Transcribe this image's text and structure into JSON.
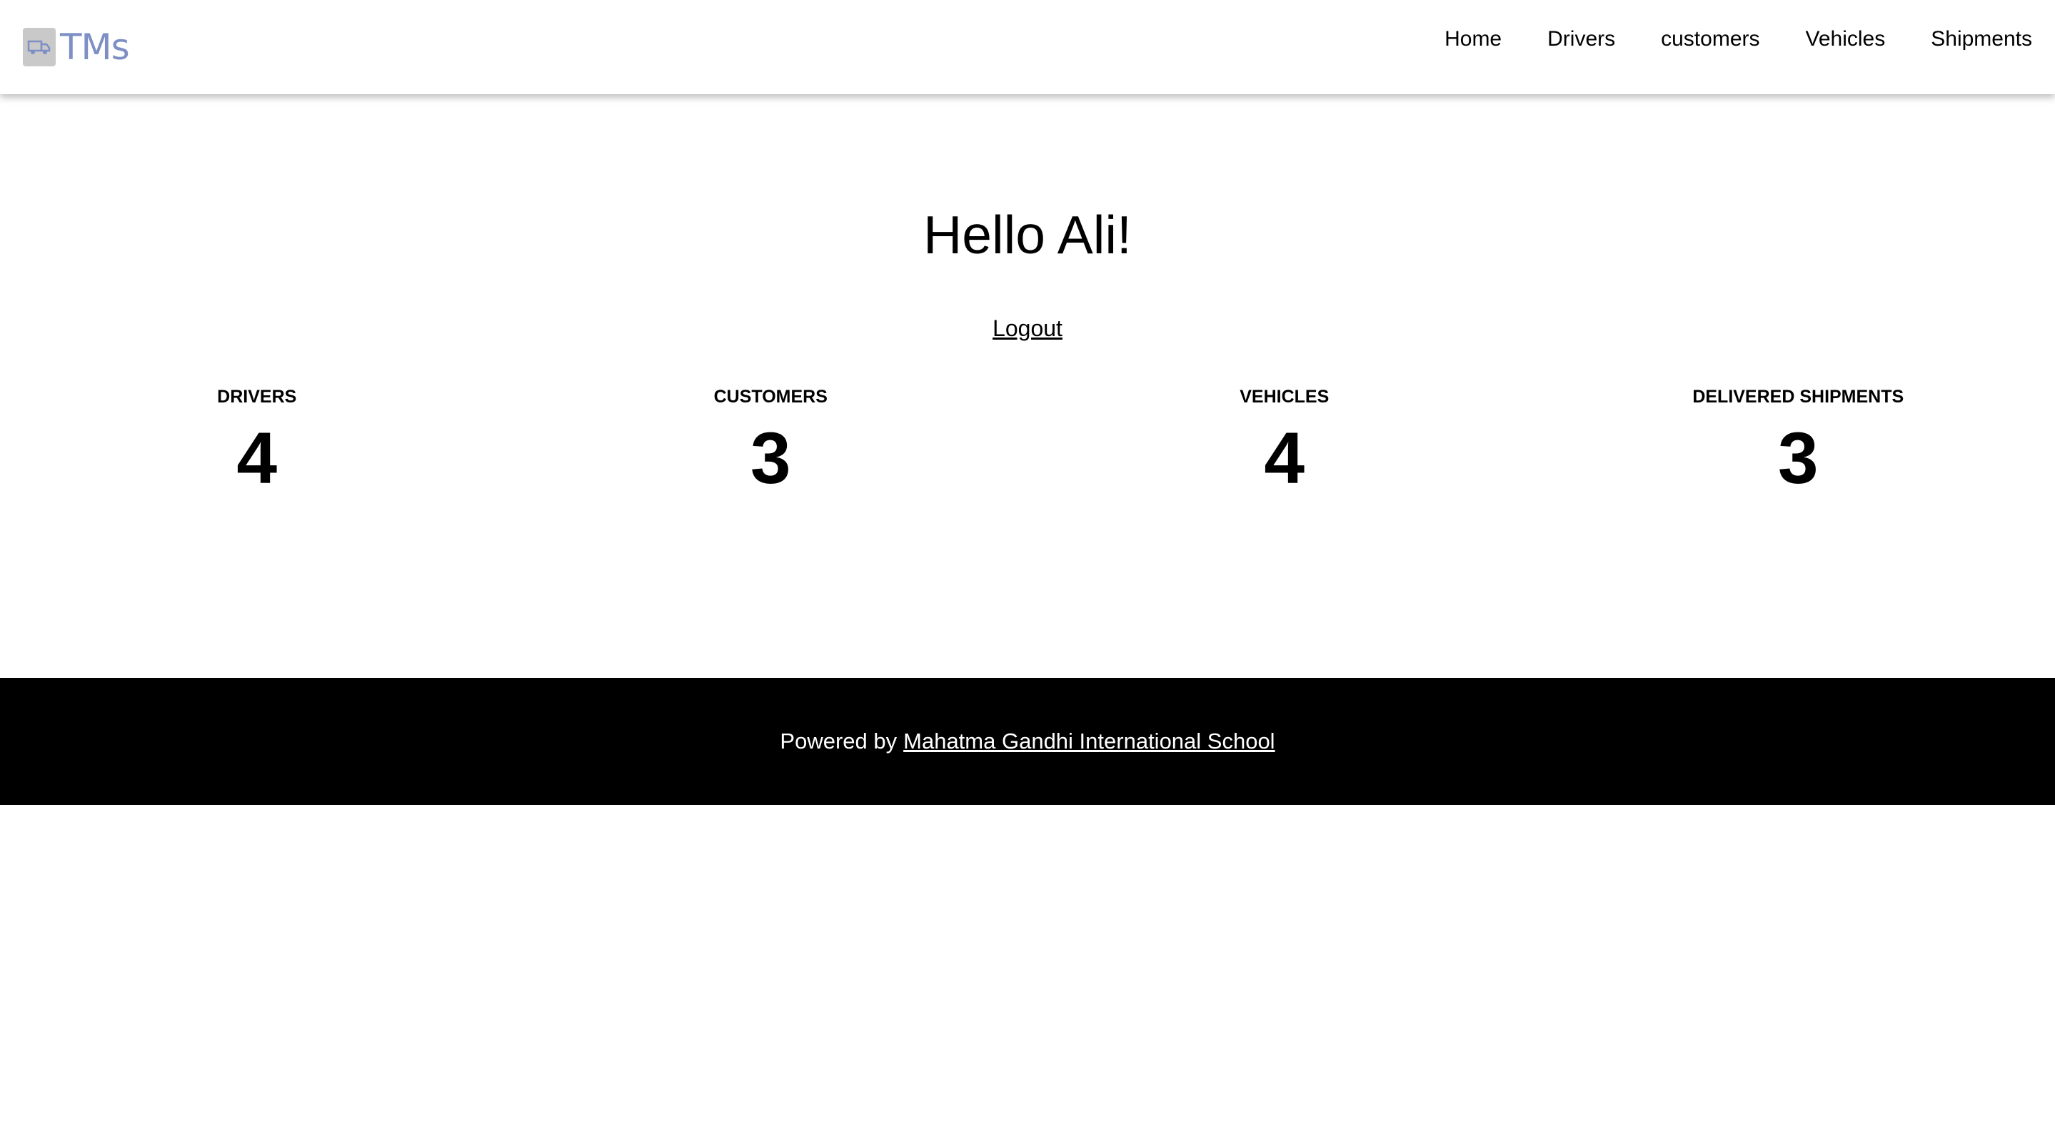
{
  "brand": {
    "name": "TMs",
    "logo_icon": "truck-icon",
    "logo_color": "#7d8fc4"
  },
  "nav": {
    "items": [
      {
        "label": "Home"
      },
      {
        "label": "Drivers"
      },
      {
        "label": "customers"
      },
      {
        "label": "Vehicles"
      },
      {
        "label": "Shipments"
      }
    ]
  },
  "main": {
    "greeting": "Hello Ali!",
    "logout_label": "Logout"
  },
  "stats": [
    {
      "label": "DRIVERS",
      "value": "4"
    },
    {
      "label": "CUSTOMERS",
      "value": "3"
    },
    {
      "label": "VEHICLES",
      "value": "4"
    },
    {
      "label": "DELIVERED SHIPMENTS",
      "value": "3"
    }
  ],
  "footer": {
    "prefix": "Powered by",
    "link_label": "Mahatma Gandhi International School",
    "background": "#000000"
  }
}
